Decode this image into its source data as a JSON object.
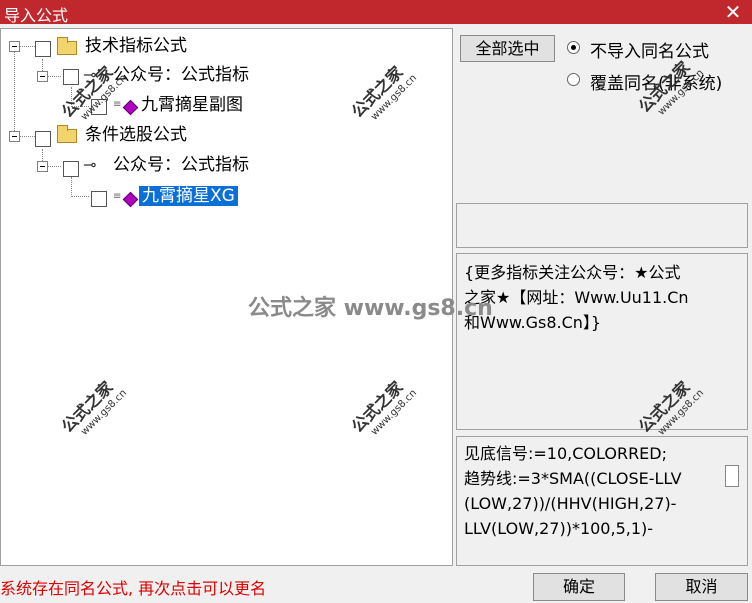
{
  "window": {
    "title": "导入公式",
    "close_glyph": "✕"
  },
  "tree": {
    "nodes": [
      {
        "label": "技术指标公式"
      },
      {
        "label": "公众号：公式指标"
      },
      {
        "label": "九霄摘星副图"
      },
      {
        "label": "条件选股公式"
      },
      {
        "label": "公众号：公式指标"
      },
      {
        "label": "九霄摘星XG",
        "selected": true
      }
    ]
  },
  "controls": {
    "select_all_label": "全部选中",
    "radio_no_import": "不导入同名公式",
    "radio_overwrite": "覆盖同名(非系统)",
    "selected_radio": "no_import"
  },
  "description_text": "{更多指标关注公众号：★公式\n之家★【网址：Www.Uu11.Cn\n和Www.Gs8.Cn】}",
  "formula_text": "见底信号:=10,COLORRED;\n趋势线:=3*SMA((CLOSE-LLV\n(LOW,27))/(HHV(HIGH,27)-\nLLV(LOW,27))*100,5,1)-",
  "status_text": "系统存在同名公式, 再次点击可以更名",
  "buttons": {
    "ok": "确定",
    "cancel": "取消"
  },
  "watermark": {
    "brand": "公式之家",
    "site": "www.gs8.cn",
    "center": "公式之家 www.gs8.cn"
  },
  "colors": {
    "title_bar": "#c0282d",
    "selection": "#0a6fd6",
    "status_text": "#e00000"
  }
}
